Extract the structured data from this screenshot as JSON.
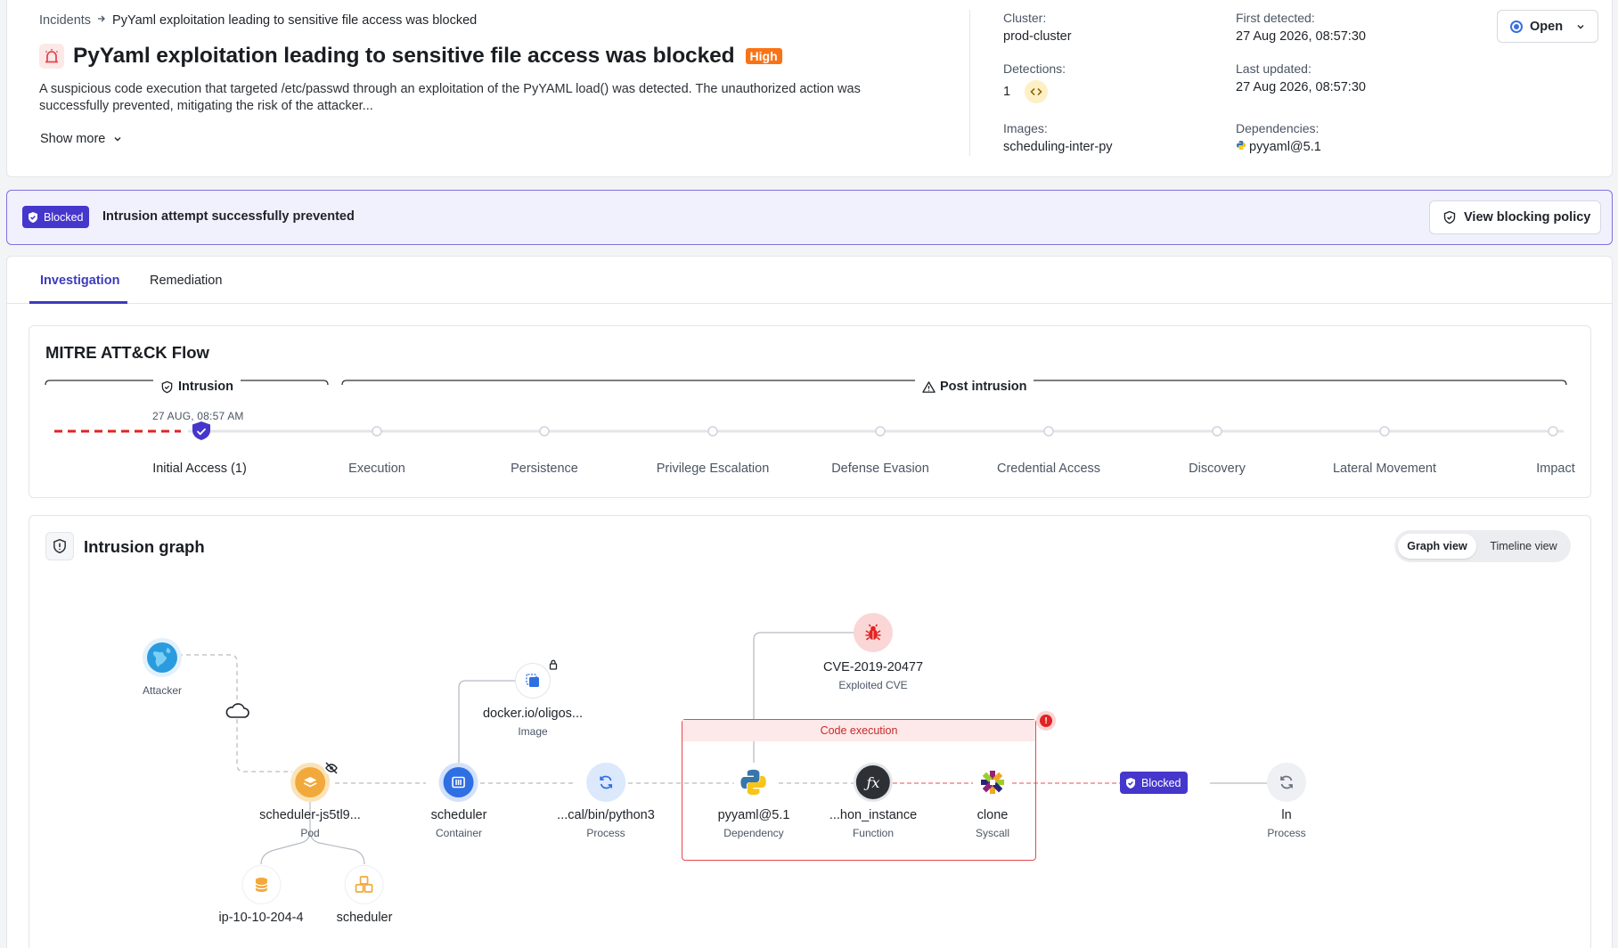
{
  "header": {
    "breadcrumb_root": "Incidents",
    "breadcrumb_current": "PyYaml exploitation leading to sensitive file access was blocked",
    "title": "PyYaml exploitation leading to sensitive file access was blocked",
    "severity": "High",
    "description": "A suspicious code execution that targeted /etc/passwd through an exploitation of the PyYAML load() was detected. The unauthorized action was successfully prevented, mitigating the risk of the attacker...",
    "show_more": "Show more",
    "meta": {
      "cluster_label": "Cluster:",
      "cluster": "prod-cluster",
      "detections_label": "Detections:",
      "detections": "1",
      "images_label": "Images:",
      "images": "scheduling-inter-py",
      "first_detected_label": "First detected:",
      "first_detected": "27 Aug 2026, 08:57:30",
      "last_updated_label": "Last updated:",
      "last_updated": "27 Aug 2026, 08:57:30",
      "dependencies_label": "Dependencies:",
      "dependencies": "pyyaml@5.1"
    },
    "status": "Open"
  },
  "banner": {
    "badge": "Blocked",
    "text": "Intrusion attempt successfully prevented",
    "policy_button": "View blocking policy"
  },
  "tabs": [
    "Investigation",
    "Remediation"
  ],
  "mitre": {
    "title": "MITRE ATT&CK Flow",
    "phase_intrusion": "Intrusion",
    "phase_post": "Post intrusion",
    "timestamp": "27 AUG, 08:57 AM",
    "stages": [
      "Initial Access (1)",
      "Execution",
      "Persistence",
      "Privilege Escalation",
      "Defense Evasion",
      "Credential Access",
      "Discovery",
      "Lateral Movement",
      "Impact"
    ]
  },
  "graph": {
    "title": "Intrusion graph",
    "view_options": [
      "Graph view",
      "Timeline view"
    ],
    "code_execution_label": "Code execution",
    "blocked_label": "Blocked",
    "nodes": {
      "attacker": {
        "label": "Attacker"
      },
      "pod": {
        "label": "scheduler-js5tl9...",
        "type": "Pod"
      },
      "container": {
        "label": "scheduler",
        "type": "Container"
      },
      "image": {
        "label": "docker.io/oligos...",
        "type": "Image"
      },
      "process": {
        "label": "...cal/bin/python3",
        "type": "Process"
      },
      "dependency": {
        "label": "pyyaml@5.1",
        "type": "Dependency"
      },
      "cve": {
        "label": "CVE-2019-20477",
        "type": "Exploited CVE"
      },
      "function": {
        "label": "...hon_instance",
        "type": "Function"
      },
      "syscall": {
        "label": "clone",
        "type": "Syscall"
      },
      "target": {
        "label": "ln",
        "type": "Process"
      },
      "node": {
        "label": "ip-10-10-204-4"
      },
      "workload": {
        "label": "scheduler"
      }
    }
  },
  "colors": {
    "accent": "#3d3bbd",
    "blocked": "#4536cc",
    "severity_high": "#f97316",
    "danger": "#e5484d"
  }
}
